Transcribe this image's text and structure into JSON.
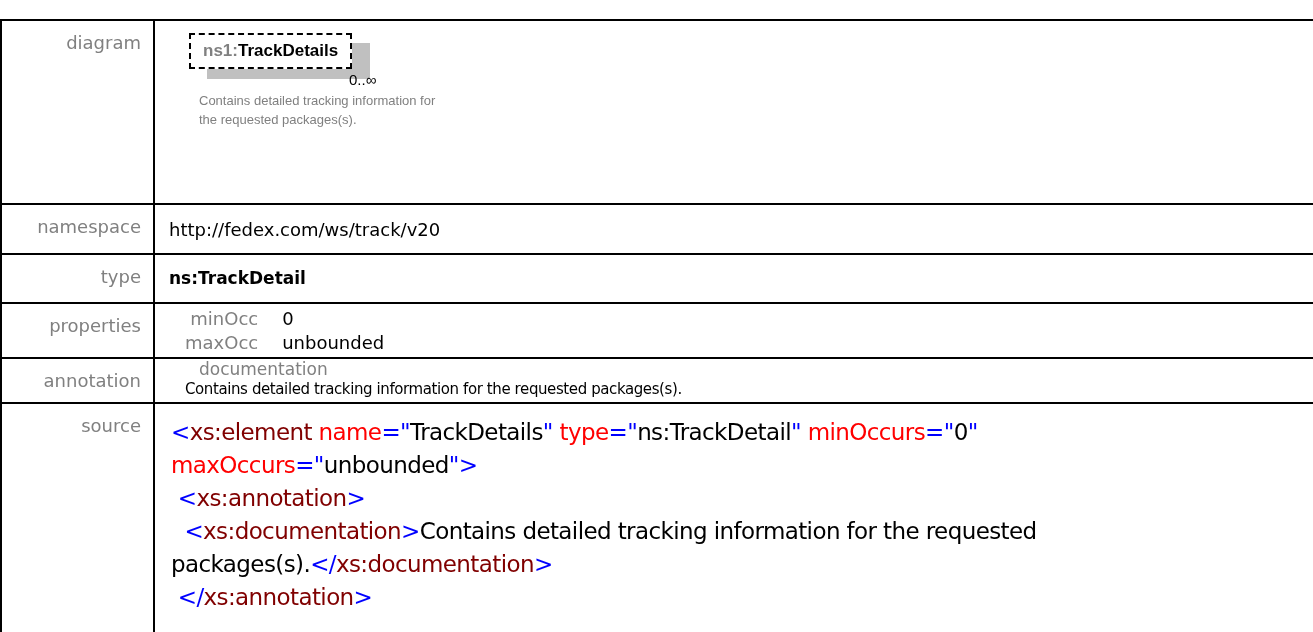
{
  "diagram": {
    "label": "diagram",
    "element": {
      "prefix": "ns1:",
      "name": "TrackDetails",
      "occurrence": "0..∞",
      "description": "Contains detailed tracking information for the requested packages(s)."
    }
  },
  "namespace": {
    "label": "namespace",
    "value": "http://fedex.com/ws/track/v20"
  },
  "type": {
    "label": "type",
    "value": "ns:TrackDetail"
  },
  "properties": {
    "label": "properties",
    "items": [
      {
        "name": "minOcc",
        "value": "0"
      },
      {
        "name": "maxOcc",
        "value": "unbounded"
      }
    ]
  },
  "annotation": {
    "label": "annotation",
    "heading": "documentation",
    "text": "Contains detailed tracking information for the requested packages(s)."
  },
  "source": {
    "label": "source",
    "lines": [
      [
        {
          "kind": "bracket",
          "text": "<"
        },
        {
          "kind": "tag",
          "text": "xs:element"
        },
        {
          "kind": "attr",
          "text": " name"
        },
        {
          "kind": "bracket",
          "text": "=\""
        },
        {
          "kind": "value",
          "text": "TrackDetails"
        },
        {
          "kind": "bracket",
          "text": "\""
        },
        {
          "kind": "attr",
          "text": " type"
        },
        {
          "kind": "bracket",
          "text": "=\""
        },
        {
          "kind": "value",
          "text": "ns:TrackDetail"
        },
        {
          "kind": "bracket",
          "text": "\""
        },
        {
          "kind": "attr",
          "text": " minOccurs"
        },
        {
          "kind": "bracket",
          "text": "=\""
        },
        {
          "kind": "value",
          "text": "0"
        },
        {
          "kind": "bracket",
          "text": "\""
        }
      ],
      [
        {
          "kind": "attr",
          "text": "maxOccurs"
        },
        {
          "kind": "bracket",
          "text": "=\""
        },
        {
          "kind": "value",
          "text": "unbounded"
        },
        {
          "kind": "bracket",
          "text": "\">"
        }
      ],
      [
        {
          "kind": "bracket",
          "text": " <"
        },
        {
          "kind": "tag",
          "text": "xs:annotation"
        },
        {
          "kind": "bracket",
          "text": ">"
        }
      ],
      [
        {
          "kind": "bracket",
          "text": "  <"
        },
        {
          "kind": "tag",
          "text": "xs:documentation"
        },
        {
          "kind": "bracket",
          "text": ">"
        },
        {
          "kind": "value",
          "text": "Contains detailed tracking information for the requested"
        }
      ],
      [
        {
          "kind": "value",
          "text": "packages(s)."
        },
        {
          "kind": "bracket",
          "text": "</"
        },
        {
          "kind": "tag",
          "text": "xs:documentation"
        },
        {
          "kind": "bracket",
          "text": ">"
        }
      ],
      [
        {
          "kind": "bracket",
          "text": " </"
        },
        {
          "kind": "tag",
          "text": "xs:annotation"
        },
        {
          "kind": "bracket",
          "text": ">"
        }
      ]
    ]
  }
}
